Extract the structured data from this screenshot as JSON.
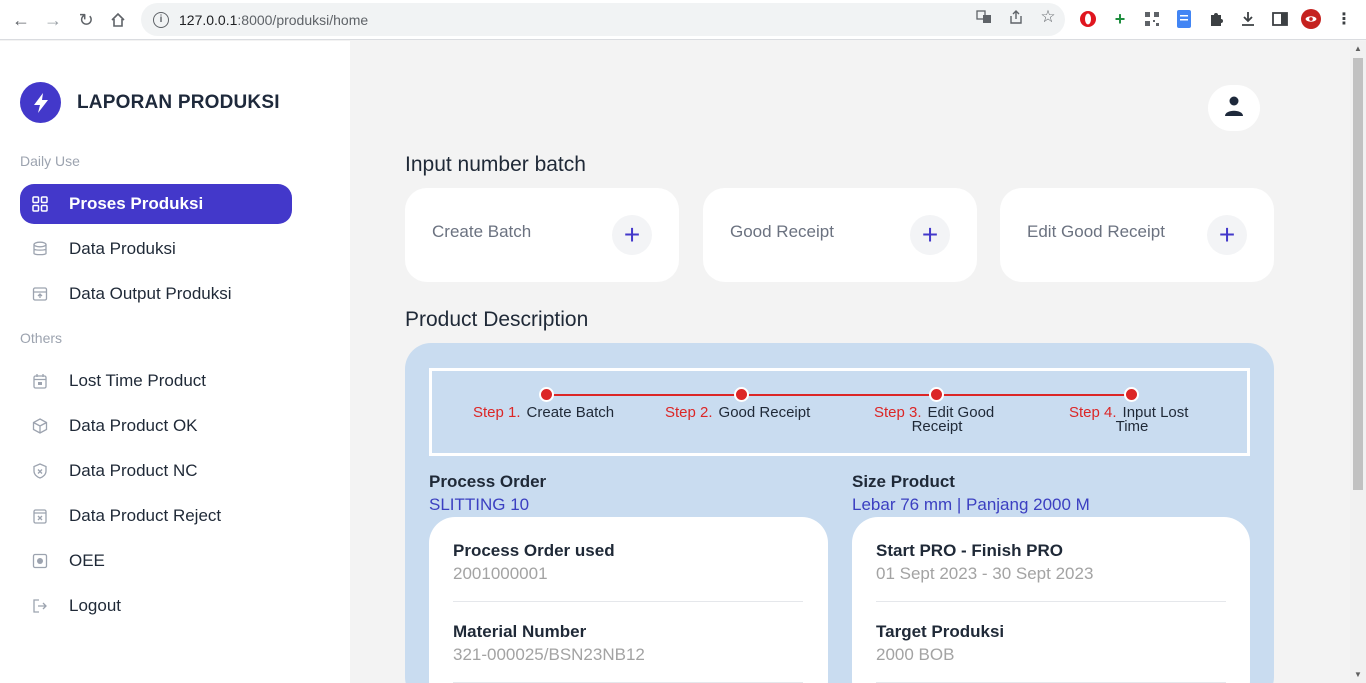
{
  "browser": {
    "url_host": "127.0.0.1",
    "url_path": ":8000/produksi/home"
  },
  "sidebar": {
    "brand": "LAPORAN PRODUKSI",
    "sections": [
      {
        "label": "Daily Use"
      },
      {
        "label": "Others"
      }
    ],
    "items": [
      {
        "label": "Proses Produksi",
        "icon": "grid-icon",
        "active": true
      },
      {
        "label": "Data Produksi",
        "icon": "database-icon"
      },
      {
        "label": "Data Output Produksi",
        "icon": "archive-icon"
      },
      {
        "label": "Lost Time Product",
        "icon": "calendar-icon"
      },
      {
        "label": "Data Product OK",
        "icon": "box-icon"
      },
      {
        "label": "Data Product NC",
        "icon": "shield-icon"
      },
      {
        "label": "Data Product Reject",
        "icon": "reject-icon"
      },
      {
        "label": "OEE",
        "icon": "oee-icon"
      },
      {
        "label": "Logout",
        "icon": "logout-icon"
      }
    ]
  },
  "main": {
    "input_title": "Input number batch",
    "actions": [
      {
        "label": "Create Batch"
      },
      {
        "label": "Good Receipt"
      },
      {
        "label": "Edit Good Receipt"
      }
    ],
    "desc_title": "Product Description",
    "steps": [
      {
        "num": "Step 1.",
        "label": "Create Batch"
      },
      {
        "num": "Step 2.",
        "label": "Good Receipt"
      },
      {
        "num": "Step 3.",
        "label": "Edit Good",
        "label2": "Receipt"
      },
      {
        "num": "Step 4.",
        "label": "Input Lost",
        "label2": "Time"
      }
    ],
    "process_order": {
      "title": "Process Order",
      "value": "SLITTING 10"
    },
    "size_product": {
      "title": "Size Product",
      "value": "Lebar 76 mm | Panjang 2000 M"
    },
    "left_card": [
      {
        "key": "Process Order used",
        "value": "2001000001"
      },
      {
        "key": "Material Number",
        "value": "321-000025/BSN23NB12"
      }
    ],
    "right_card": [
      {
        "key": "Start PRO - Finish PRO",
        "value": "01 Sept 2023 - 30 Sept 2023"
      },
      {
        "key": "Target Produksi",
        "value": "2000 BOB"
      }
    ]
  },
  "colors": {
    "accent": "#4338ca",
    "step_red": "#dc2626",
    "panel_blue": "#c9dcf0"
  }
}
